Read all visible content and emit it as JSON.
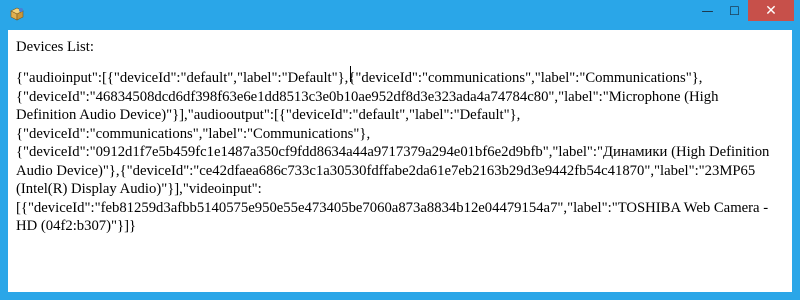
{
  "window": {
    "controls": {
      "minimize": "—",
      "maximize": "☐",
      "close": "✕"
    },
    "accent": "#2aa6e8",
    "close_color": "#c7504a"
  },
  "content": {
    "title": "Devices List:",
    "devices_json": "{\"audioinput\":[{\"deviceId\":\"default\",\"label\":\"Default\"},{\"deviceId\":\"communications\",\"label\":\"Communications\"},{\"deviceId\":\"46834508dcd6df398f63e6e1dd8513c3e0b10ae952df8d3e323ada4a74784c80\",\"label\":\"Microphone (High Definition Audio Device)\"}],\"audiooutput\":[{\"deviceId\":\"default\",\"label\":\"Default\"},{\"deviceId\":\"communications\",\"label\":\"Communications\"},{\"deviceId\":\"0912d1f7e5b459fc1e1487a350cf9fdd8634a44a9717379a294e01bf6e2d9bfb\",\"label\":\"Динамики (High Definition Audio Device)\"},{\"deviceId\":\"ce42dfaea686c733c1a30530fdffabe2da61e7eb2163b29d3e9442fb54c41870\",\"label\":\"23MP65 (Intel(R) Display Audio)\"}],\"videoinput\":[{\"deviceId\":\"feb81259d3afbb5140575e950e55e473405be7060a873a8834b12e04479154a7\",\"label\":\"TOSHIBA Web Camera - HD (04f2:b307)\"}]}"
  }
}
